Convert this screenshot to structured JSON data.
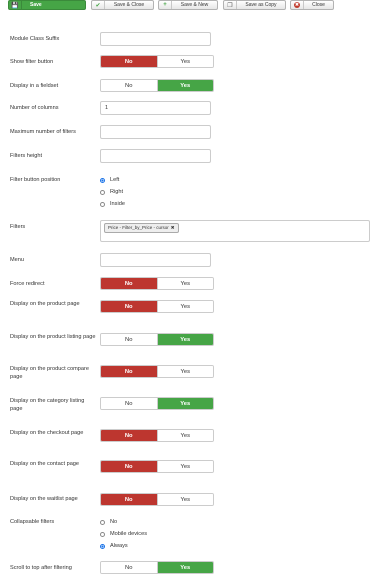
{
  "toolbar": {
    "save": "Save",
    "save_close": "Save & Close",
    "save_new": "Save & New",
    "save_copy": "Save as Copy",
    "close": "Close"
  },
  "fields": {
    "module_class_suffix": {
      "label": "Module Class Suffix",
      "value": ""
    },
    "show_filter_button": {
      "label": "Show filter button",
      "no": "No",
      "yes": "Yes",
      "selected": "No"
    },
    "display_in_fieldset": {
      "label": "Display in a fieldset",
      "no": "No",
      "yes": "Yes",
      "selected": "Yes"
    },
    "number_of_columns": {
      "label": "Number of columns",
      "value": "1"
    },
    "maximum_number_of_filters": {
      "label": "Maximum number of filters",
      "value": ""
    },
    "filters_height": {
      "label": "Filters height",
      "value": ""
    },
    "filter_button_position": {
      "label": "Filter button position",
      "options": [
        "Left",
        "Right",
        "Inside"
      ],
      "selected": "Left"
    },
    "filters": {
      "label": "Filters",
      "tag": "Price - Filter_by_Price - cursor",
      "tag_remove": "✖"
    },
    "menu": {
      "label": "Menu",
      "value": ""
    },
    "force_redirect": {
      "label": "Force redirect",
      "no": "No",
      "yes": "Yes",
      "selected": "No"
    },
    "display_on_product_page": {
      "label": "Display on the product page",
      "no": "No",
      "yes": "Yes",
      "selected": "No"
    },
    "display_on_product_listing_page": {
      "label": "Display on the product listing page",
      "no": "No",
      "yes": "Yes",
      "selected": "Yes"
    },
    "display_on_product_compare_page": {
      "label": "Display on the product compare page",
      "no": "No",
      "yes": "Yes",
      "selected": "No"
    },
    "display_on_category_listing_page": {
      "label": "Display on the category listing page",
      "no": "No",
      "yes": "Yes",
      "selected": "Yes"
    },
    "display_on_checkout_page": {
      "label": "Display on the checkout page",
      "no": "No",
      "yes": "Yes",
      "selected": "No"
    },
    "display_on_contact_page": {
      "label": "Display on the contact page",
      "no": "No",
      "yes": "Yes",
      "selected": "No"
    },
    "display_on_waitlist_page": {
      "label": "Display on the waitlist page",
      "no": "No",
      "yes": "Yes",
      "selected": "No"
    },
    "collapsable_filters": {
      "label": "Collapsable filters",
      "options": [
        "No",
        "Mobile devices",
        "Always"
      ],
      "selected": "Always"
    },
    "scroll_to_top": {
      "label": "Scroll to top after filtering",
      "no": "No",
      "yes": "Yes",
      "selected": "Yes"
    }
  },
  "colors": {
    "success": "#46a546",
    "danger": "#bd362f",
    "radio_selected": "#1a73e8"
  },
  "icons": {
    "save": "save-icon",
    "save_close": "check-icon",
    "save_new": "plus-icon",
    "save_copy": "copy-icon",
    "close": "close-icon"
  }
}
